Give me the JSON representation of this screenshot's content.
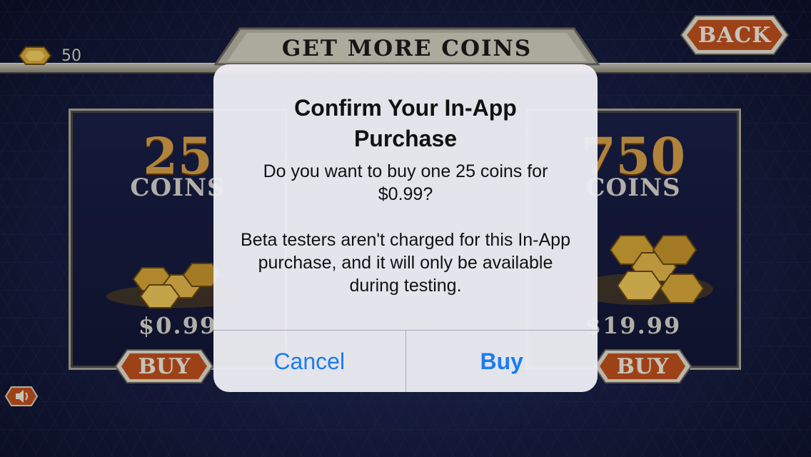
{
  "header": {
    "title": "GET MORE COINS",
    "back_label": "BACK",
    "coin_balance": "50"
  },
  "products": [
    {
      "amount": "25",
      "unit": "COINS",
      "price": "$0.99",
      "buy_label": "BUY"
    },
    {
      "amount": "750",
      "unit": "COINS",
      "price": "$19.99",
      "buy_label": "BUY"
    }
  ],
  "alert": {
    "title": "Confirm Your In-App Purchase",
    "message": "Do you want to buy one 25 coins for $0.99?",
    "note": "Beta testers aren't charged for this In-App purchase, and it will only be available during testing.",
    "cancel_label": "Cancel",
    "confirm_label": "Buy"
  },
  "colors": {
    "alert_button": "#1a7cf2",
    "buy_button": "#c0511d",
    "coin_gold": "#d7a04a"
  },
  "icons": {
    "coin": "coin-icon",
    "sound": "speaker-icon"
  }
}
